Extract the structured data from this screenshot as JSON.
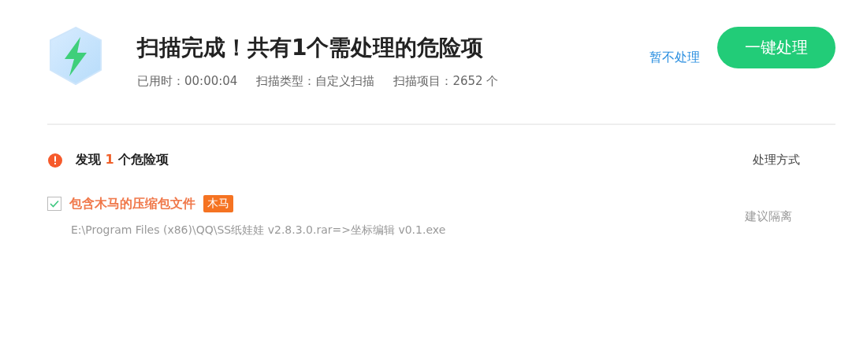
{
  "header": {
    "title": "扫描完成！共有1个需处理的危险项",
    "stats": [
      "已用时：00:00:04",
      "扫描类型：自定义扫描",
      "扫描项目：2652 个"
    ],
    "skip_link": "暂不处理",
    "fix_button": "一键处理"
  },
  "results": {
    "heading": {
      "prefix": "发现",
      "count": "1",
      "suffix": "个危险项"
    },
    "action_column": "处理方式",
    "items": [
      {
        "title": "包含木马的压缩包文件",
        "tag": "木马",
        "path": "E:\\Program Files (x86)\\QQ\\SS纸娃娃 v2.8.3.0.rar=>坐标编辑 v0.1.exe",
        "action": "建议隔离",
        "checked": true
      }
    ]
  }
}
